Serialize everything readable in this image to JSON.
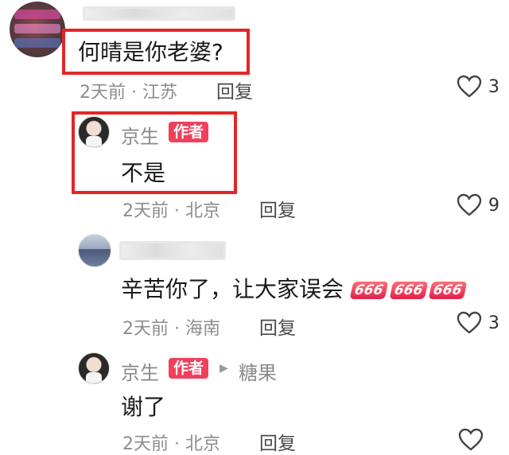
{
  "comments": [
    {
      "text": "何晴是你老婆?",
      "time": "2天前",
      "location": "江苏",
      "reply_label": "回复",
      "likes": "3"
    },
    {
      "name": "京生",
      "badge": "作者",
      "text": "不是",
      "time": "2天前",
      "location": "北京",
      "reply_label": "回复",
      "likes": "9"
    },
    {
      "text": "辛苦你了，让大家误会",
      "emoji": [
        "666",
        "666",
        "666"
      ],
      "time": "2天前",
      "location": "海南",
      "reply_label": "回复",
      "likes": "3"
    },
    {
      "name": "京生",
      "badge": "作者",
      "reply_to": "糖果",
      "text": "谢了",
      "time": "2天前",
      "location": "北京",
      "reply_label": "回复"
    }
  ],
  "separator": "·",
  "colors": {
    "badge": "#f0405c",
    "highlight_box": "#e32626",
    "meta": "#8c8c8c"
  }
}
